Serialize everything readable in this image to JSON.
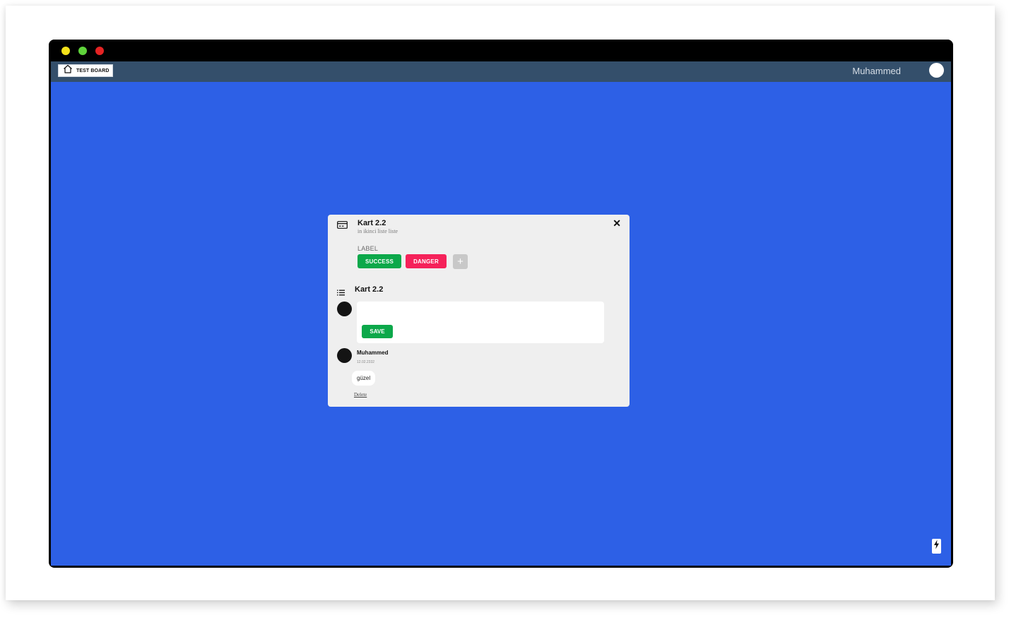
{
  "window": {
    "traffic_lights": [
      {
        "name": "minimize",
        "color": "#f4e21a"
      },
      {
        "name": "maximize",
        "color": "#5fd33b"
      },
      {
        "name": "close",
        "color": "#e52323"
      }
    ]
  },
  "navbar": {
    "board_label": "TEST BOARD",
    "board_icon": "home-icon",
    "username": "Muhammed",
    "bg_color": "#344f6b"
  },
  "board": {
    "bg_color": "#2d60e6"
  },
  "card_modal": {
    "title": "Kart 2.2",
    "subtitle": "in ikinci liste liste",
    "close_label": "✕",
    "labels_heading": "LABEL",
    "labels": [
      {
        "text": "SUCCESS",
        "color": "#0ca84a"
      },
      {
        "text": "DANGER",
        "color": "#f5225a"
      }
    ],
    "add_label_symbol": "+",
    "description_title": "Kart 2.2",
    "comment_input": {
      "value": "",
      "placeholder": ""
    },
    "save_label": "SAVE",
    "comments": [
      {
        "author": "Muhammed",
        "date": "12.02.2332",
        "text": "güzel",
        "delete_label": "Delete"
      }
    ]
  },
  "floating": {
    "bolt_icon": "lightning-bolt-icon"
  }
}
